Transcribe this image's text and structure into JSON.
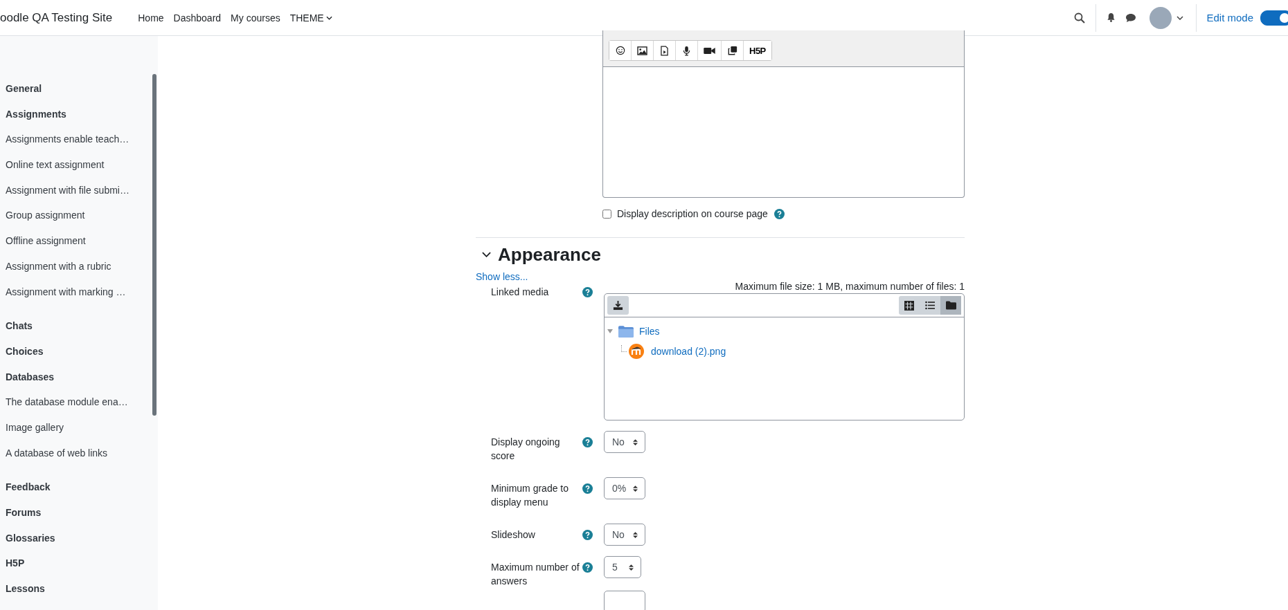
{
  "header": {
    "site_name": "oodle QA Testing Site",
    "nav": [
      {
        "label": "Home",
        "dropdown": false
      },
      {
        "label": "Dashboard",
        "dropdown": false
      },
      {
        "label": "My courses",
        "dropdown": false
      },
      {
        "label": "THEME",
        "dropdown": true
      }
    ],
    "edit_mode": {
      "label": "Edit mode",
      "on": true
    }
  },
  "sidebar": {
    "items": [
      {
        "label": "General",
        "kind": "section"
      },
      {
        "label": "Assignments",
        "kind": "section"
      },
      {
        "label": "Assignments enable teach…",
        "kind": "activity"
      },
      {
        "label": "Online text assignment",
        "kind": "activity"
      },
      {
        "label": "Assignment with file submi…",
        "kind": "activity"
      },
      {
        "label": "Group assignment",
        "kind": "activity"
      },
      {
        "label": "Offline assignment",
        "kind": "activity"
      },
      {
        "label": "Assignment with a rubric",
        "kind": "activity"
      },
      {
        "label": "Assignment with marking …",
        "kind": "activity"
      },
      {
        "label": "Chats",
        "kind": "section"
      },
      {
        "label": "Choices",
        "kind": "section"
      },
      {
        "label": "Databases",
        "kind": "section"
      },
      {
        "label": "The database module ena…",
        "kind": "activity"
      },
      {
        "label": "Image gallery",
        "kind": "activity"
      },
      {
        "label": "A database of web links",
        "kind": "activity"
      },
      {
        "label": "Feedback",
        "kind": "section"
      },
      {
        "label": "Forums",
        "kind": "section"
      },
      {
        "label": "Glossaries",
        "kind": "section"
      },
      {
        "label": "H5P",
        "kind": "section"
      },
      {
        "label": "Lessons",
        "kind": "section"
      }
    ]
  },
  "editor": {
    "toolbar": [
      {
        "kind": "emoji"
      },
      {
        "kind": "image"
      },
      {
        "kind": "media"
      },
      {
        "kind": "microphone"
      },
      {
        "kind": "video"
      },
      {
        "kind": "copy"
      },
      {
        "kind": "h5p",
        "label": "H5P"
      }
    ]
  },
  "display_description": {
    "label": "Display description on course page",
    "checked": false
  },
  "section": {
    "title": "Appearance",
    "expanded": true,
    "toggle_link": "Show less..."
  },
  "file_manager": {
    "label": "Linked media",
    "limits": "Maximum file size: 1 MB, maximum number of files: 1",
    "views": [
      {
        "kind": "grid",
        "selected": false
      },
      {
        "kind": "list",
        "selected": false
      },
      {
        "kind": "tree",
        "selected": true
      }
    ],
    "tree": [
      {
        "label": "Files",
        "kind": "folder",
        "expanded": true,
        "children": [
          {
            "label": "download (2).png",
            "kind": "image"
          }
        ]
      }
    ]
  },
  "fields": [
    {
      "label": "Display ongoing score",
      "value": "No"
    },
    {
      "label": "Minimum grade to display menu",
      "value": "0%"
    },
    {
      "label": "Slideshow",
      "value": "No"
    },
    {
      "label": "Maximum number of answers",
      "value": "5"
    }
  ]
}
